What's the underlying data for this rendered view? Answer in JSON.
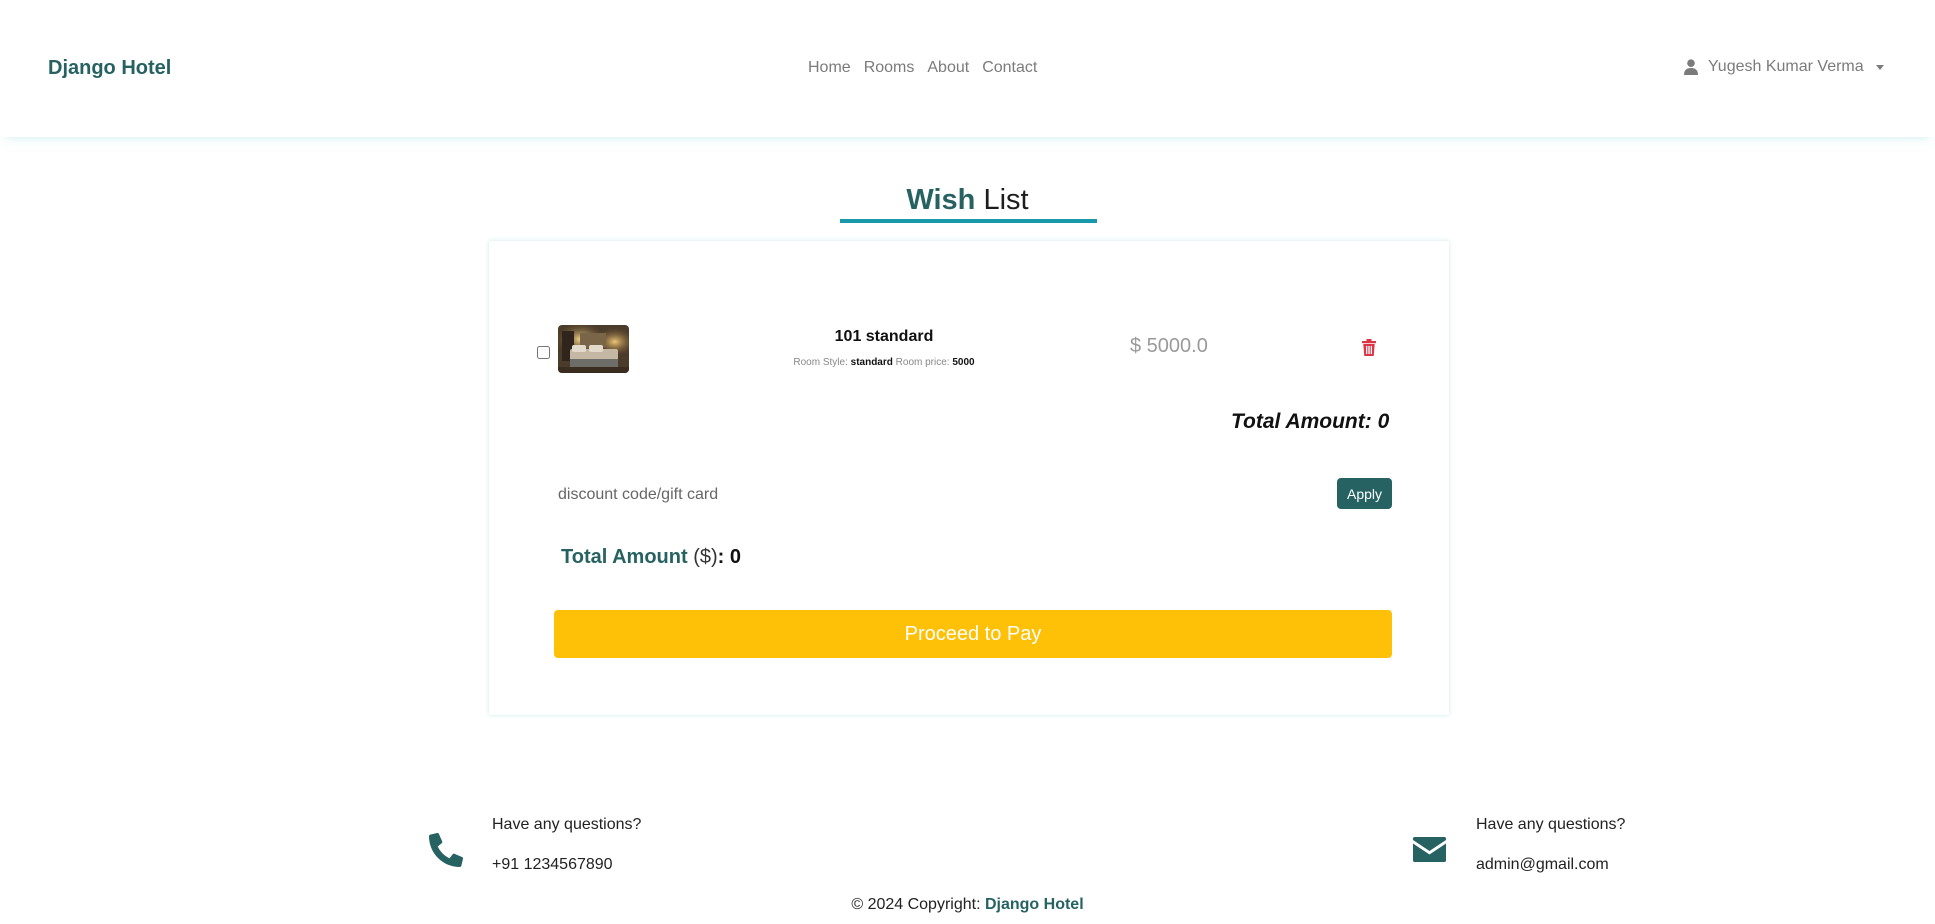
{
  "navbar": {
    "brand": "Django Hotel",
    "links": [
      "Home",
      "Rooms",
      "About",
      "Contact"
    ],
    "user_name": "Yugesh Kumar Verma"
  },
  "heading": {
    "bold": "Wish",
    "rest": "List"
  },
  "wishlist": {
    "items": [
      {
        "title": "101 standard",
        "style_label": "Room Style:",
        "style_value": "standard",
        "price_label": "Room price:",
        "price_value": "5000",
        "price_display": "$ 5000.0",
        "checked": false
      }
    ],
    "total_label": "Total Amount: 0"
  },
  "discount": {
    "placeholder": "discount code/gift card",
    "value": "",
    "apply_label": "Apply"
  },
  "total": {
    "label": "Total Amount",
    "currency": "($)",
    "value": ": 0"
  },
  "pay_label": "Proceed to Pay",
  "footer": {
    "phone": {
      "heading": "Have any questions?",
      "value": "+91 1234567890"
    },
    "email": {
      "heading": "Have any questions?",
      "value": "admin@gmail.com"
    },
    "copyright_prefix": "© 2024 Copyright:",
    "copyright_brand": "Django Hotel"
  },
  "colors": {
    "brand": "#276262",
    "accent": "#1a98ab",
    "pay": "#ffc107",
    "danger": "#dc3545"
  },
  "icons": [
    "user-icon",
    "trash-icon",
    "phone-icon",
    "envelope-icon"
  ]
}
